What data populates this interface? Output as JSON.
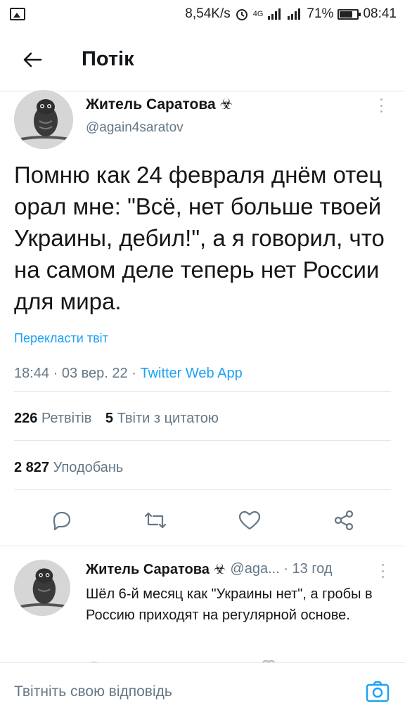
{
  "status_bar": {
    "speed": "8,54K/s",
    "network": "4G",
    "battery": "71%",
    "time": "08:41"
  },
  "header": {
    "title": "Потік"
  },
  "tweet": {
    "author_name": "Житель Саратова ☣",
    "author_handle": "@again4saratov",
    "text": "Помню как 24 февраля днём отец орал мне: \"Всё, нет больше твоей Украины, дебил!\", а я говорил, что на самом деле теперь нет России для мира.",
    "translate_label": "Перекласти твіт",
    "time": "18:44",
    "date": "03 вер. 22",
    "app": "Twitter Web App",
    "retweets_count": "226",
    "retweets_label": "Ретвітів",
    "quotes_count": "5",
    "quotes_label": "Твіти з цитатою",
    "likes_count": "2 827",
    "likes_label": "Уподобань"
  },
  "reply": {
    "author_name": "Житель Саратова ☣",
    "author_handle": "@aga...",
    "time": "13 год",
    "text": "Шёл 6-й месяц как \"Украины нет\", а гробы в Россию приходят на регулярной основе."
  },
  "compose": {
    "placeholder": "Твітніть свою відповідь"
  },
  "colors": {
    "accent": "#1da1f2",
    "secondary_text": "#657786",
    "border": "#e1e8ed"
  },
  "icons": [
    "back-arrow-icon",
    "more-vert-icon",
    "reply-icon",
    "retweet-icon",
    "like-icon",
    "share-icon",
    "camera-icon"
  ]
}
